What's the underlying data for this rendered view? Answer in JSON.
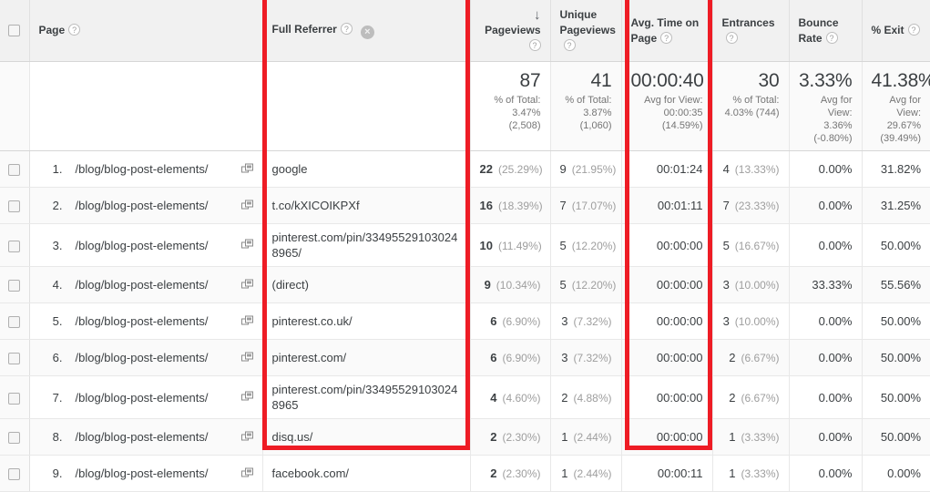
{
  "table": {
    "columns": [
      {
        "id": "checkbox",
        "label": "",
        "icon": "checkbox-icon"
      },
      {
        "id": "page",
        "label": "Page",
        "help": "?"
      },
      {
        "id": "full_referrer",
        "label": "Full Referrer",
        "help": "?",
        "remove": "×"
      },
      {
        "id": "pageviews",
        "label": "Pageviews",
        "help": "?",
        "sort": "↓"
      },
      {
        "id": "unique_pageviews",
        "label": "Unique Pageviews",
        "help": "?"
      },
      {
        "id": "avg_time_on_page",
        "label": "Avg. Time on Page",
        "help": "?"
      },
      {
        "id": "entrances",
        "label": "Entrances",
        "help": "?"
      },
      {
        "id": "bounce_rate",
        "label": "Bounce Rate",
        "help": "?"
      },
      {
        "id": "exit_pct",
        "label": "% Exit",
        "help": "?"
      }
    ],
    "header": {
      "page": "Page",
      "full_referrer": "Full Referrer",
      "pageviews": "Pageviews",
      "unique_pageviews_l1": "Unique",
      "unique_pageviews_l2": "Pageviews",
      "avg_time_l1": "Avg. Time on",
      "avg_time_l2": "Page",
      "entrances": "Entrances",
      "bounce_l1": "Bounce",
      "bounce_l2": "Rate",
      "exit": "% Exit",
      "help_glyph": "?",
      "remove_glyph": "×",
      "sort_glyph": "↓"
    },
    "summary": {
      "pageviews": {
        "value": "87",
        "sub": "% of Total:\n3.47% (2,508)"
      },
      "unique_pageviews": {
        "value": "41",
        "sub": "% of Total:\n3.87%\n(1,060)"
      },
      "avg_time_on_page": {
        "value": "00:00:40",
        "sub": "Avg for View:\n00:00:35\n(14.59%)"
      },
      "entrances": {
        "value": "30",
        "sub": "% of Total:\n4.03% (744)"
      },
      "bounce_rate": {
        "value": "3.33%",
        "sub": "Avg for\nView:\n3.36%\n(-0.80%)"
      },
      "exit_pct": {
        "value": "41.38%",
        "sub": "Avg for View:\n29.67%\n(39.49%)"
      }
    },
    "rows": [
      {
        "num": "1.",
        "page": "/blog/blog-post-elements/",
        "full_referrer": "google",
        "pageviews": "22",
        "pageviews_pct": "(25.29%)",
        "unique_pageviews": "9",
        "unique_pageviews_pct": "(21.95%)",
        "avg_time_on_page": "00:01:24",
        "entrances": "4",
        "entrances_pct": "(13.33%)",
        "bounce_rate": "0.00%",
        "exit_pct": "31.82%"
      },
      {
        "num": "2.",
        "page": "/blog/blog-post-elements/",
        "full_referrer": "t.co/kXICOIKPXf",
        "pageviews": "16",
        "pageviews_pct": "(18.39%)",
        "unique_pageviews": "7",
        "unique_pageviews_pct": "(17.07%)",
        "avg_time_on_page": "00:01:11",
        "entrances": "7",
        "entrances_pct": "(23.33%)",
        "bounce_rate": "0.00%",
        "exit_pct": "31.25%"
      },
      {
        "num": "3.",
        "page": "/blog/blog-post-elements/",
        "full_referrer": "pinterest.com/pin/334955291030248965/",
        "pageviews": "10",
        "pageviews_pct": "(11.49%)",
        "unique_pageviews": "5",
        "unique_pageviews_pct": "(12.20%)",
        "avg_time_on_page": "00:00:00",
        "entrances": "5",
        "entrances_pct": "(16.67%)",
        "bounce_rate": "0.00%",
        "exit_pct": "50.00%"
      },
      {
        "num": "4.",
        "page": "/blog/blog-post-elements/",
        "full_referrer": "(direct)",
        "pageviews": "9",
        "pageviews_pct": "(10.34%)",
        "unique_pageviews": "5",
        "unique_pageviews_pct": "(12.20%)",
        "avg_time_on_page": "00:00:00",
        "entrances": "3",
        "entrances_pct": "(10.00%)",
        "bounce_rate": "33.33%",
        "exit_pct": "55.56%"
      },
      {
        "num": "5.",
        "page": "/blog/blog-post-elements/",
        "full_referrer": "pinterest.co.uk/",
        "pageviews": "6",
        "pageviews_pct": "(6.90%)",
        "unique_pageviews": "3",
        "unique_pageviews_pct": "(7.32%)",
        "avg_time_on_page": "00:00:00",
        "entrances": "3",
        "entrances_pct": "(10.00%)",
        "bounce_rate": "0.00%",
        "exit_pct": "50.00%"
      },
      {
        "num": "6.",
        "page": "/blog/blog-post-elements/",
        "full_referrer": "pinterest.com/",
        "pageviews": "6",
        "pageviews_pct": "(6.90%)",
        "unique_pageviews": "3",
        "unique_pageviews_pct": "(7.32%)",
        "avg_time_on_page": "00:00:00",
        "entrances": "2",
        "entrances_pct": "(6.67%)",
        "bounce_rate": "0.00%",
        "exit_pct": "50.00%"
      },
      {
        "num": "7.",
        "page": "/blog/blog-post-elements/",
        "full_referrer": "pinterest.com/pin/334955291030248965",
        "pageviews": "4",
        "pageviews_pct": "(4.60%)",
        "unique_pageviews": "2",
        "unique_pageviews_pct": "(4.88%)",
        "avg_time_on_page": "00:00:00",
        "entrances": "2",
        "entrances_pct": "(6.67%)",
        "bounce_rate": "0.00%",
        "exit_pct": "50.00%"
      },
      {
        "num": "8.",
        "page": "/blog/blog-post-elements/",
        "full_referrer": "disq.us/",
        "pageviews": "2",
        "pageviews_pct": "(2.30%)",
        "unique_pageviews": "1",
        "unique_pageviews_pct": "(2.44%)",
        "avg_time_on_page": "00:00:00",
        "entrances": "1",
        "entrances_pct": "(3.33%)",
        "bounce_rate": "0.00%",
        "exit_pct": "50.00%"
      },
      {
        "num": "9.",
        "page": "/blog/blog-post-elements/",
        "full_referrer": "facebook.com/",
        "pageviews": "2",
        "pageviews_pct": "(2.30%)",
        "unique_pageviews": "1",
        "unique_pageviews_pct": "(2.44%)",
        "avg_time_on_page": "00:00:11",
        "entrances": "1",
        "entrances_pct": "(3.33%)",
        "bounce_rate": "0.00%",
        "exit_pct": "0.00%"
      }
    ]
  },
  "annotations": {
    "color": "#ee1c25",
    "boxes": [
      {
        "id": "full-referrer",
        "target": "Full Referrer column"
      },
      {
        "id": "avg-time",
        "target": "Avg. Time on Page column"
      }
    ]
  }
}
